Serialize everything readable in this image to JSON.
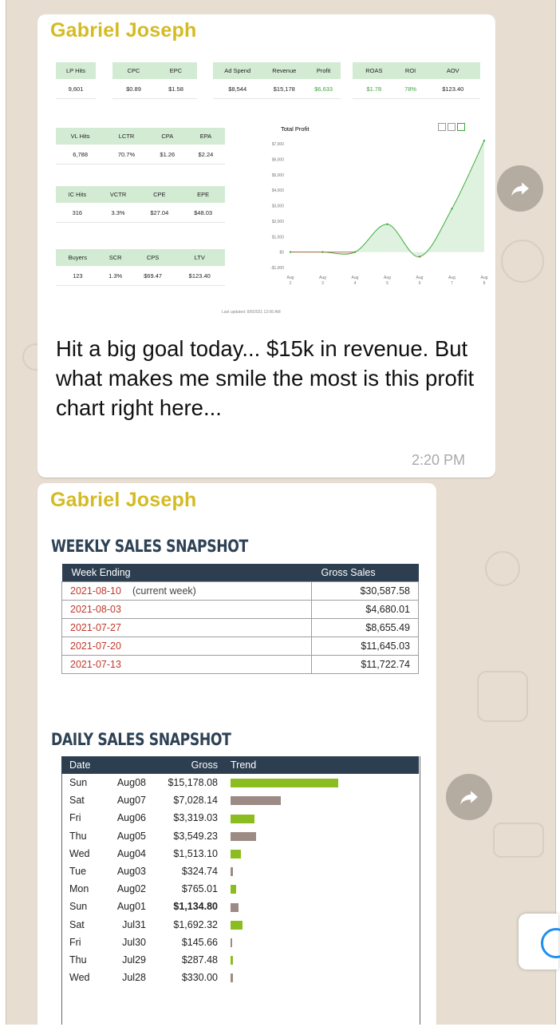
{
  "messages": [
    {
      "sender": "Gabriel Joseph",
      "text": "Hit a big goal today... $15k in revenue.  But what makes me smile the most is this profit chart right here...",
      "time": "2:20 PM"
    },
    {
      "sender": "Gabriel Joseph"
    }
  ],
  "dashboard": {
    "lp": {
      "headers": [
        "LP Hits"
      ],
      "values": [
        "9,601"
      ]
    },
    "cpc": {
      "headers": [
        "CPC",
        "EPC"
      ],
      "values": [
        "$0.89",
        "$1.58"
      ]
    },
    "ad": {
      "headers": [
        "Ad Spend",
        "Revenue",
        "Profit"
      ],
      "values": [
        "$8,544",
        "$15,178",
        "$6,633"
      ]
    },
    "roas": {
      "headers": [
        "ROAS",
        "ROI",
        "AOV"
      ],
      "values": [
        "$1.78",
        "78%",
        "$123.40"
      ]
    },
    "vl": {
      "headers": [
        "VL Hits",
        "LCTR",
        "CPA",
        "EPA"
      ],
      "values": [
        "6,788",
        "70.7%",
        "$1.26",
        "$2.24"
      ]
    },
    "ic": {
      "headers": [
        "IC Hits",
        "VCTR",
        "CPE",
        "EPE"
      ],
      "values": [
        "316",
        "3.3%",
        "$27.04",
        "$48.03"
      ]
    },
    "buyers": {
      "headers": [
        "Buyers",
        "SCR",
        "CPS",
        "LTV"
      ],
      "values": [
        "123",
        "1.3%",
        "$69.47",
        "$123.40"
      ]
    },
    "last_updated": "Last updated: 8/9/2021 12:06 AM",
    "colors": {
      "header_bg": "#d3ebd3",
      "positive": "#3ea33e"
    }
  },
  "chart_data": {
    "type": "area",
    "title": "Total Profit",
    "x": [
      "Aug 2",
      "Aug 3",
      "Aug 4",
      "Aug 5",
      "Aug 6",
      "Aug 7",
      "Aug 8"
    ],
    "x_ticks": [
      [
        "Aug",
        "2"
      ],
      [
        "Aug",
        "3"
      ],
      [
        "Aug",
        "4"
      ],
      [
        "Aug",
        "5"
      ],
      [
        "Aug",
        "6"
      ],
      [
        "Aug",
        "7"
      ],
      [
        "Aug",
        "8"
      ]
    ],
    "values": [
      0,
      0,
      0,
      1800,
      -300,
      2800,
      7200
    ],
    "ylim": [
      -1000,
      7000
    ],
    "yticks": [
      "$7,000",
      "$6,000",
      "$5,000",
      "$4,000",
      "$3,000",
      "$2,000",
      "$1,000",
      "$0",
      "-$1,000"
    ],
    "grid": false,
    "colors": {
      "positive": "#3cae3c",
      "negative": "#d94848",
      "fill": "#dff1df"
    }
  },
  "weekly": {
    "title": "WEEKLY SALES SNAPSHOT",
    "headers": [
      "Week Ending",
      "Gross Sales"
    ],
    "current_note": "(current week)",
    "rows": [
      {
        "date": "2021-08-10",
        "amount": "$30,587.58"
      },
      {
        "date": "2021-08-03",
        "amount": "$4,680.01"
      },
      {
        "date": "2021-07-27",
        "amount": "$8,655.49"
      },
      {
        "date": "2021-07-20",
        "amount": "$11,645.03"
      },
      {
        "date": "2021-07-13",
        "amount": "$11,722.74"
      }
    ]
  },
  "daily": {
    "title": "DAILY SALES SNAPSHOT",
    "headers": [
      "Date",
      "Gross",
      "Trend"
    ],
    "rows": [
      {
        "day": "Sun",
        "date": "Aug08",
        "gross": "$15,178.08",
        "value": 15178.08,
        "color": "green"
      },
      {
        "day": "Sat",
        "date": "Aug07",
        "gross": "$7,028.14",
        "value": 7028.14,
        "color": "brown"
      },
      {
        "day": "Fri",
        "date": "Aug06",
        "gross": "$3,319.03",
        "value": 3319.03,
        "color": "green"
      },
      {
        "day": "Thu",
        "date": "Aug05",
        "gross": "$3,549.23",
        "value": 3549.23,
        "color": "brown"
      },
      {
        "day": "Wed",
        "date": "Aug04",
        "gross": "$1,513.10",
        "value": 1513.1,
        "color": "green"
      },
      {
        "day": "Tue",
        "date": "Aug03",
        "gross": "$324.74",
        "value": 324.74,
        "color": "brown"
      },
      {
        "day": "Mon",
        "date": "Aug02",
        "gross": "$765.01",
        "value": 765.01,
        "color": "green"
      },
      {
        "day": "Sun",
        "date": "Aug01",
        "gross": "$1,134.80",
        "value": 1134.8,
        "color": "brown",
        "bold": true
      },
      {
        "day": "Sat",
        "date": "Jul31",
        "gross": "$1,692.32",
        "value": 1692.32,
        "color": "green"
      },
      {
        "day": "Fri",
        "date": "Jul30",
        "gross": "$145.66",
        "value": 145.66,
        "color": "brown"
      },
      {
        "day": "Thu",
        "date": "Jul29",
        "gross": "$287.48",
        "value": 287.48,
        "color": "green"
      },
      {
        "day": "Wed",
        "date": "Jul28",
        "gross": "$330.00",
        "value": 330.0,
        "color": "brown"
      }
    ],
    "colors": {
      "green": "#8cbd20",
      "brown": "#9c8a84",
      "header": "#2c3e50"
    }
  },
  "icons": {
    "forward": "forward-arrow-icon"
  }
}
